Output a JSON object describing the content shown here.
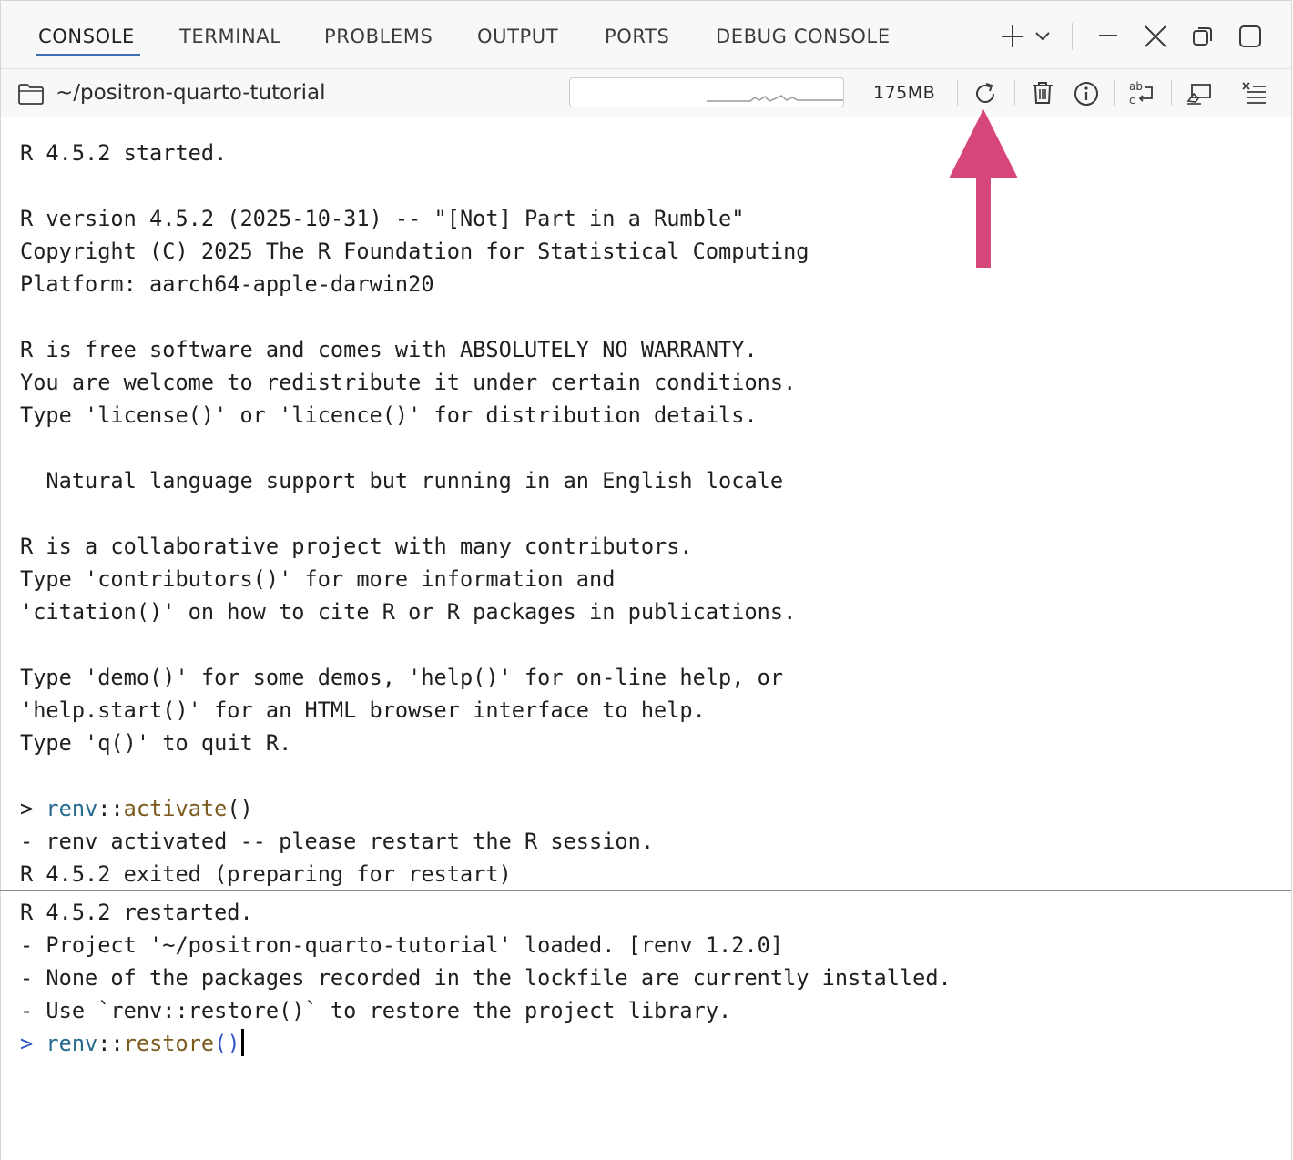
{
  "tabs": [
    {
      "label": "CONSOLE",
      "active": true
    },
    {
      "label": "TERMINAL",
      "active": false
    },
    {
      "label": "PROBLEMS",
      "active": false
    },
    {
      "label": "OUTPUT",
      "active": false
    },
    {
      "label": "PORTS",
      "active": false
    },
    {
      "label": "DEBUG CONSOLE",
      "active": false
    }
  ],
  "window_controls": {
    "icons": [
      "plus-icon",
      "chevron-down-icon",
      "minimize-icon",
      "close-icon",
      "restore-icon",
      "maximize-icon"
    ]
  },
  "toolbar": {
    "path": "~/positron-quarto-tutorial",
    "memory": "175MB",
    "icons": [
      "folder-icon",
      "restart-icon",
      "trash-icon",
      "info-icon",
      "word-wrap-icon",
      "clear-icon",
      "list-icon"
    ]
  },
  "console": {
    "lines": [
      "R 4.5.2 started.",
      "",
      "R version 4.5.2 (2025-10-31) -- \"[Not] Part in a Rumble\"",
      "Copyright (C) 2025 The R Foundation for Statistical Computing",
      "Platform: aarch64-apple-darwin20",
      "",
      "R is free software and comes with ABSOLUTELY NO WARRANTY.",
      "You are welcome to redistribute it under certain conditions.",
      "Type 'license()' or 'licence()' for distribution details.",
      "",
      "  Natural language support but running in an English locale",
      "",
      "R is a collaborative project with many contributors.",
      "Type 'contributors()' for more information and",
      "'citation()' on how to cite R or R packages in publications.",
      "",
      "Type 'demo()' for some demos, 'help()' for on-line help, or",
      "'help.start()' for an HTML browser interface to help.",
      "Type 'q()' to quit R."
    ],
    "cmd1": {
      "prompt": "> ",
      "ns": "renv",
      "sep": "::",
      "fn": "activate",
      "parens": "()"
    },
    "after_cmd1": [
      "- renv activated -- please restart the R session.",
      "R 4.5.2 exited (preparing for restart)"
    ],
    "after_restart": [
      "R 4.5.2 restarted.",
      "- Project '~/positron-quarto-tutorial' loaded. [renv 1.2.0]",
      "- None of the packages recorded in the lockfile are currently installed.",
      "- Use `renv::restore()` to restore the project library."
    ],
    "cmd2": {
      "prompt": "> ",
      "ns": "renv",
      "sep": "::",
      "fn": "restore",
      "parens": "()"
    }
  },
  "colors": {
    "accent": "#3f6fb3",
    "annotation_arrow": "#d6467b"
  }
}
